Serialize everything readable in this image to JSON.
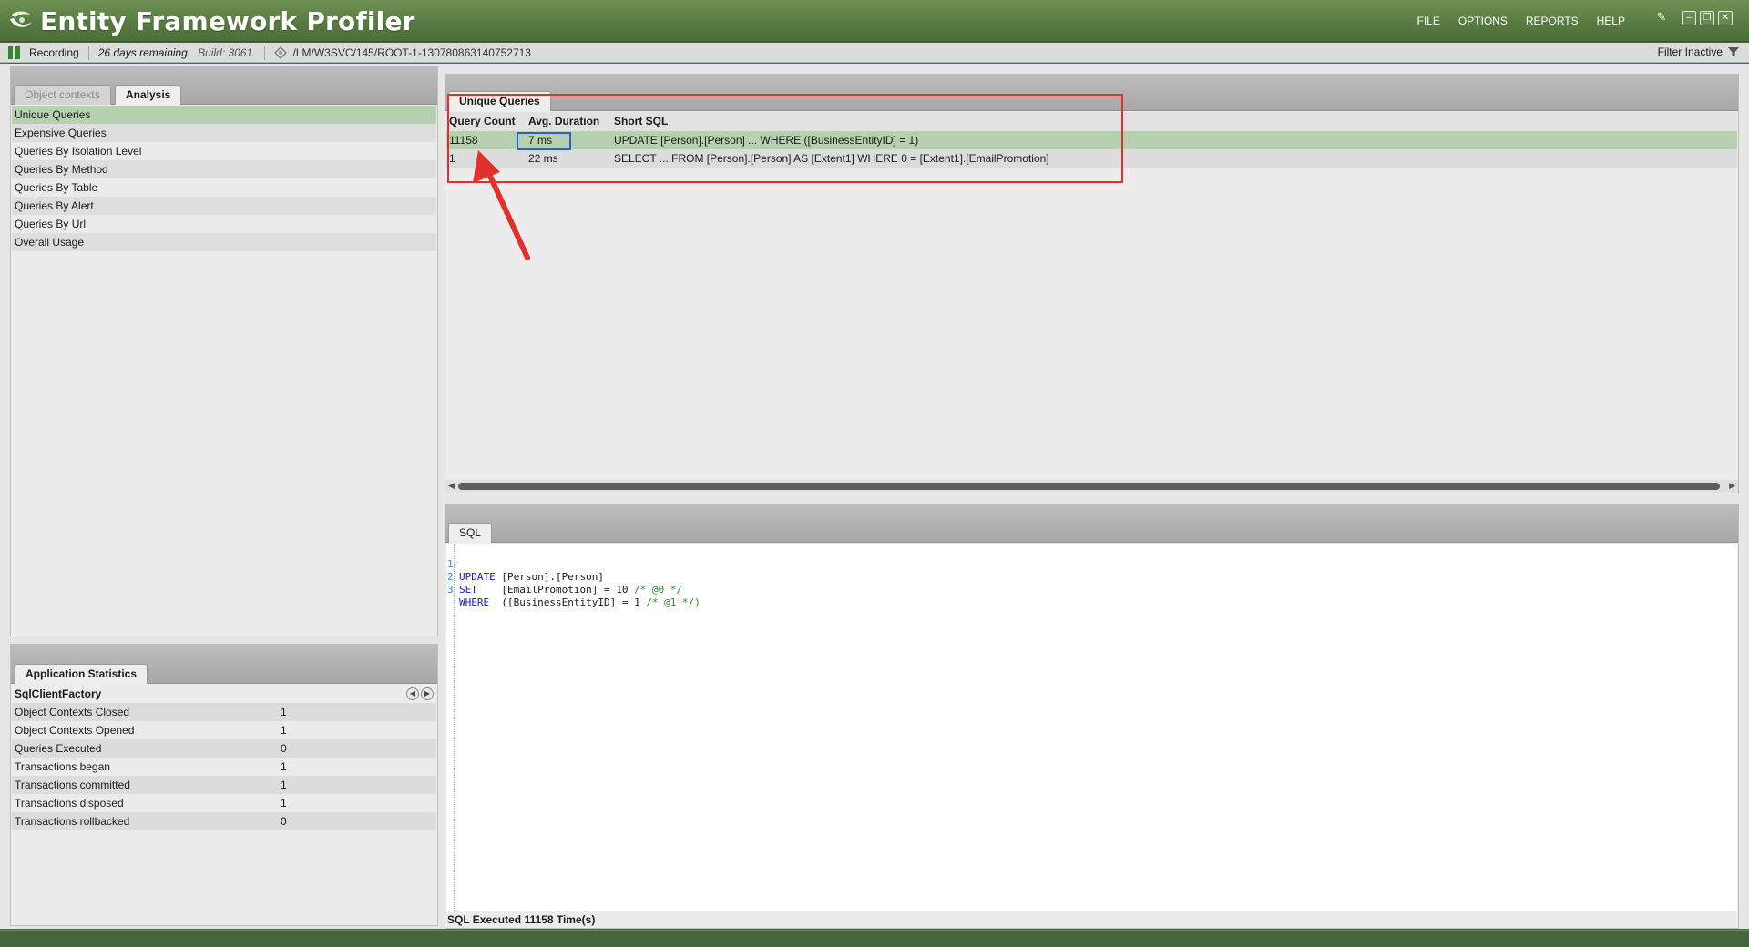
{
  "app": {
    "title": "Entity Framework Profiler"
  },
  "menu": [
    "FILE",
    "OPTIONS",
    "REPORTS",
    "HELP"
  ],
  "status": {
    "recording": "Recording",
    "remaining": "26 days remaining.",
    "build": "Build: 3061.",
    "path": "/LM/W3SVC/145/ROOT-1-130780863140752713",
    "filter": "Filter Inactive"
  },
  "left_tabs": {
    "object_contexts": "Object contexts",
    "analysis": "Analysis"
  },
  "nav_items": [
    "Unique Queries",
    "Expensive Queries",
    "Queries By Isolation Level",
    "Queries By Method",
    "Queries By Table",
    "Queries By Alert",
    "Queries By Url",
    "Overall Usage"
  ],
  "stats": {
    "tab": "Application Statistics",
    "factory": "SqlClientFactory",
    "rows": [
      {
        "label": "Object Contexts Closed",
        "value": "1"
      },
      {
        "label": "Object Contexts Opened",
        "value": "1"
      },
      {
        "label": "Queries Executed",
        "value": "0"
      },
      {
        "label": "Transactions began",
        "value": "1"
      },
      {
        "label": "Transactions committed",
        "value": "1"
      },
      {
        "label": "Transactions disposed",
        "value": "1"
      },
      {
        "label": "Transactions rollbacked",
        "value": "0"
      }
    ]
  },
  "queries": {
    "tab": "Unique Queries",
    "columns": [
      "Query Count",
      "Avg. Duration",
      "Short SQL"
    ],
    "rows": [
      {
        "count": "11158",
        "duration": "7 ms",
        "sql": "UPDATE [Person].[Person] ... WHERE ([BusinessEntityID] = 1)"
      },
      {
        "count": "1",
        "duration": "22 ms",
        "sql": "SELECT ... FROM [Person].[Person] AS [Extent1] WHERE 0 = [Extent1].[EmailPromotion]"
      }
    ]
  },
  "sql": {
    "tab": "SQL",
    "lines": [
      {
        "num": "1",
        "kw": "UPDATE",
        "rest": " [Person].[Person]",
        "comment": ""
      },
      {
        "num": "2",
        "kw": "SET",
        "rest": "    [EmailPromotion] = 10 ",
        "comment": "/* @0 */"
      },
      {
        "num": "3",
        "kw": "WHERE",
        "rest": "  ([BusinessEntityID] = 1 ",
        "comment": "/* @1 */)"
      }
    ],
    "footer": "SQL Executed 11158 Time(s)"
  },
  "colors": {
    "titlebar": "#5a7d44",
    "selection": "#b5d1b0",
    "annotation_red": "#e2312c",
    "annotation_blue": "#2a63cf"
  }
}
